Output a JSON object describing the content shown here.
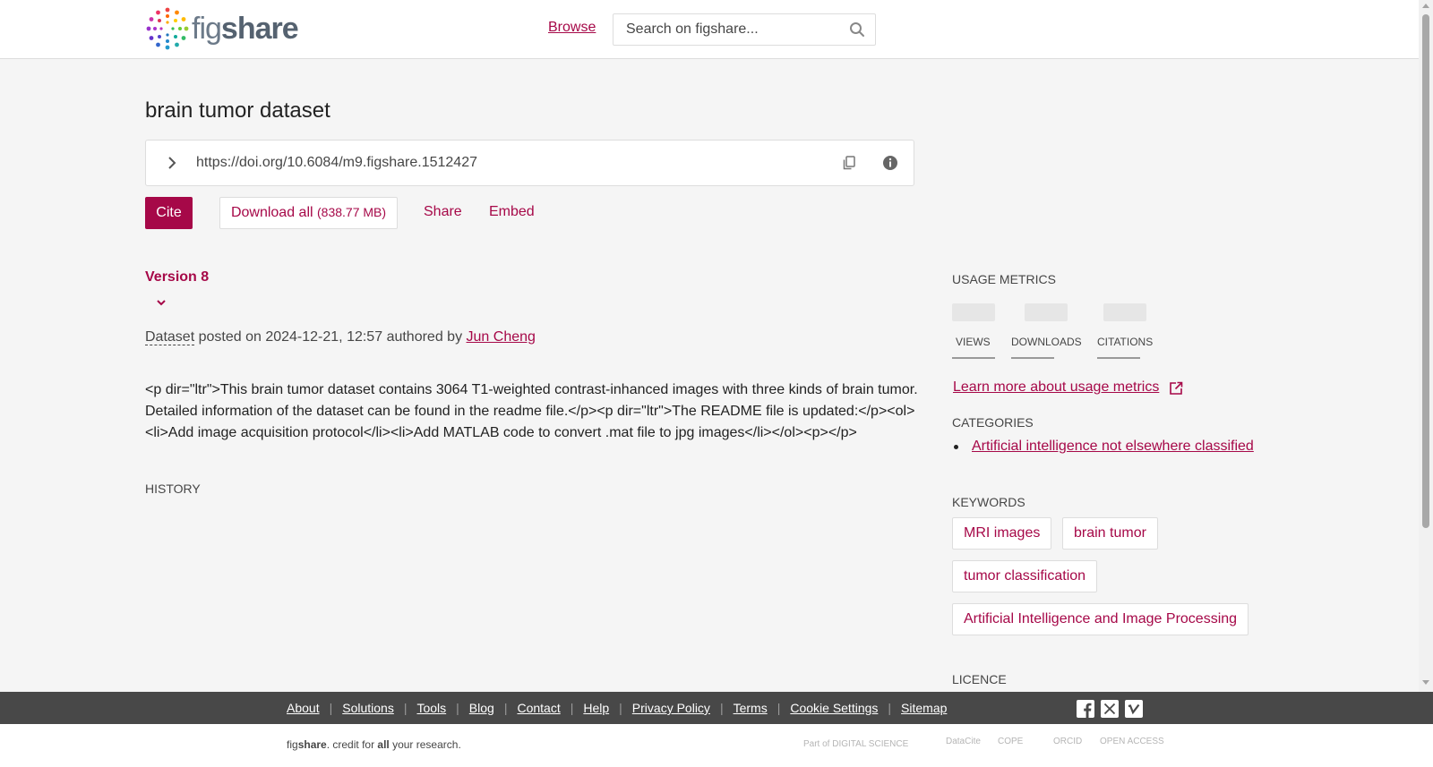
{
  "header": {
    "logo": {
      "fig": "fig",
      "share": "share"
    },
    "browse_label": "Browse",
    "search_placeholder": "Search on figshare..."
  },
  "item": {
    "title": "brain tumor dataset",
    "doi_url": "https://doi.org/10.6084/m9.figshare.1512427",
    "actions": {
      "cite_label": "Cite",
      "download_label": "Download all",
      "download_size": "(838.77 MB)",
      "share_label": "Share",
      "embed_label": "Embed"
    },
    "version_label": "Version 8",
    "item_type": "Dataset",
    "posted_prefix": "posted on",
    "posted_date": "2024-12-21, 12:57",
    "authored_by": "authored by",
    "author": "Jun Cheng",
    "description": "<p dir=\"ltr\">This brain tumor dataset contains 3064 T1-weighted contrast-inhanced images with three kinds of brain tumor. Detailed information of the dataset can be found in the readme file.</p><p dir=\"ltr\">The README file is updated:</p><ol><li>Add image acquisition protocol</li><li>Add MATLAB code to convert .mat file to jpg images</li></ol><p></p>",
    "history_heading": "HISTORY"
  },
  "sidebar": {
    "usage_metrics_heading": "USAGE METRICS",
    "metrics": [
      {
        "label": "VIEWS"
      },
      {
        "label": "DOWNLOADS"
      },
      {
        "label": "CITATIONS"
      }
    ],
    "learn_more_label": "Learn more about usage metrics",
    "categories_heading": "CATEGORIES",
    "categories": [
      "Artificial intelligence not elsewhere classified"
    ],
    "keywords_heading": "KEYWORDS",
    "keywords": [
      "MRI images",
      "brain tumor",
      "tumor classification",
      "Artificial Intelligence and Image Processing"
    ],
    "licence_heading": "LICENCE"
  },
  "footer": {
    "links": [
      "About",
      "Solutions",
      "Tools",
      "Blog",
      "Contact",
      "Help",
      "Privacy Policy",
      "Terms",
      "Cookie Settings",
      "Sitemap"
    ],
    "tagline": {
      "fig": "fig",
      "share": "share",
      "mid": ". credit for ",
      "all": "all",
      "end": " your research."
    },
    "partners": [
      "Part of DIGITAL SCIENCE",
      "DataCite",
      "COPE",
      "ORCID",
      "OPEN ACCESS"
    ]
  },
  "colors": {
    "accent": "#a60848",
    "footer_bg": "#484848",
    "page_bg": "#f5f5f5"
  }
}
